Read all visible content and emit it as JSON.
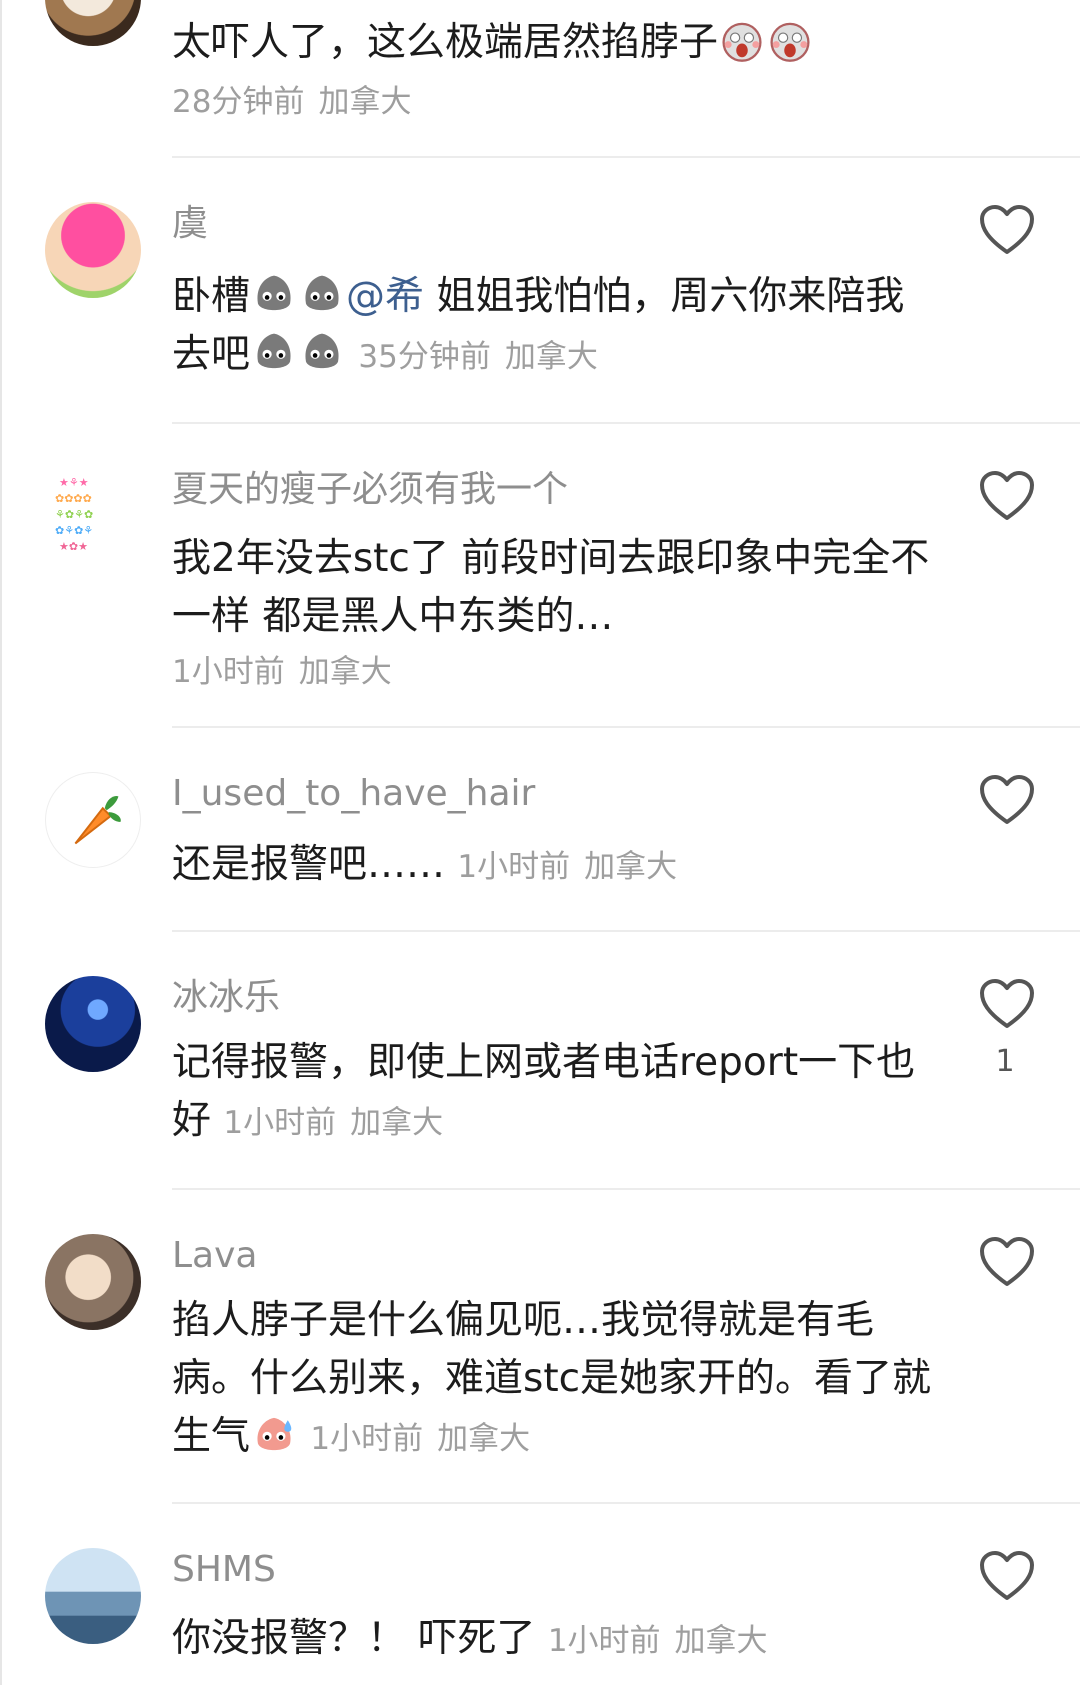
{
  "comments": [
    {
      "username": "",
      "text": "太吓人了，这么极端居然掐脖子",
      "time": "28分钟前",
      "location": "加拿大",
      "emojis": [
        "scream-emoji",
        "scream-emoji"
      ]
    },
    {
      "username": "虞",
      "text_before": "卧槽",
      "mention": "@希",
      "text_after": " 姐姐我怕怕，周六你来陪我去吧",
      "time": "35分钟前",
      "location": "加拿大",
      "emojis": [
        "grey-blob-emoji",
        "grey-blob-emoji",
        "grey-blob-emoji",
        "grey-blob-emoji"
      ]
    },
    {
      "username": "夏天的瘦子必须有我一个",
      "text": "我2年没去stc了 前段时间去跟印象中完全不一样 都是黑人中东类的…",
      "time": "1小时前",
      "location": "加拿大"
    },
    {
      "username": "I_used_to_have_hair",
      "text": "还是报警吧……",
      "time": "1小时前",
      "location": "加拿大"
    },
    {
      "username": "冰冰乐",
      "text": "记得报警，即使上网或者电话report一下也好",
      "time": "1小时前",
      "location": "加拿大",
      "likes": "1"
    },
    {
      "username": "Lava",
      "text": "掐人脖子是什么偏见呃…我觉得就是有毛病。什么别来，难道stc是她家开的。看了就生气",
      "time": "1小时前",
      "location": "加拿大",
      "emojis": [
        "sweat-pink-emoji"
      ]
    },
    {
      "username": "SHMS",
      "text": "你没报警？！ 吓死了",
      "time": "1小时前",
      "location": "加拿大"
    }
  ],
  "icons": {
    "like": "heart-outline-icon"
  },
  "colors": {
    "accent_mention": "#3d5f8f",
    "meta": "#9e9e9e",
    "username": "#8e8e8e"
  }
}
